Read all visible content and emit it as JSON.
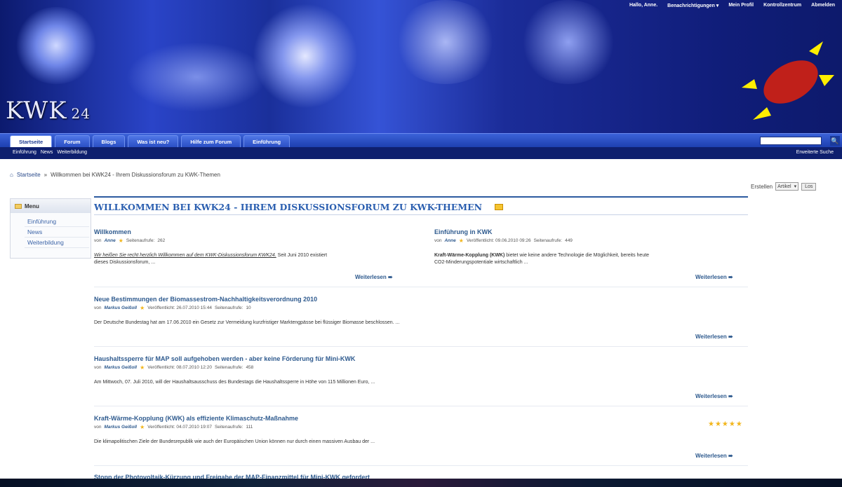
{
  "userbar": {
    "greeting": "Hallo, Anne.",
    "notifications": "Benachrichtigungen ▾",
    "profile": "Mein Profil",
    "control": "Kontrollzentrum",
    "logout": "Abmelden"
  },
  "logo": {
    "text": "KWK",
    "suffix": "24"
  },
  "nav": {
    "tabs": [
      "Startseite",
      "Forum",
      "Blogs",
      "Was ist neu?",
      "Hilfe zum Forum",
      "Einführung"
    ],
    "search_icon": "search-icon"
  },
  "subnav": {
    "links": [
      "Einführung",
      "News",
      "Weiterbildung"
    ],
    "advanced": "Erweiterte Suche"
  },
  "breadcrumb": {
    "home": "Startseite",
    "sep": "»",
    "current": "Willkommen bei KWK24 - Ihrem Diskussionsforum zu KWK-Themen"
  },
  "create": {
    "label": "Erstellen",
    "select": "Artikel",
    "button": "Los"
  },
  "menu": {
    "title": "Menu",
    "items": [
      "Einführung",
      "News",
      "Weiterbildung"
    ]
  },
  "main": {
    "title": "WILLKOMMEN BEI KWK24 - IHREM DISKUSSIONSFORUM ZU KWK-THEMEN"
  },
  "articles": [
    {
      "title": "Willkommen",
      "by": "von",
      "author": "Anne",
      "views_label": "Seitenaufrufe:",
      "views": "262",
      "body_u": "Wir heißen Sie recht herzlich Willkommen auf dem KWK-Diskussionsforum KWK24.",
      "body": " Seit Juni 2010 existiert",
      "body2": "dieses Diskussionsforum, ...",
      "more": "Weiterlesen ➠"
    },
    {
      "title": "Einführung in KWK",
      "by": "von",
      "author": "Anne",
      "date": "Veröffentlicht: 09.06.2010 09:26",
      "views_label": "Seitenaufrufe:",
      "views": "449",
      "body_b": "Kraft-Wärme-Kopplung (KWK)",
      "body": " bietet wie keine andere Technologie die Möglichkeit, bereits heute",
      "body2": "CO2-Minderungspotentiale wirtschaftlich ...",
      "more": "Weiterlesen ➠"
    },
    {
      "title": "Neue Bestimmungen der Biomassestrom-Nachhaltigkeitsverordnung 2010",
      "by": "von",
      "author": "Markus Geißoll",
      "date": "Veröffentlicht: 26.07.2010 15:44",
      "views_label": "Seitenaufrufe:",
      "views": "10",
      "body": "Der Deutsche Bundestag hat am 17.06.2010 ein Gesetz zur Vermeidung kurzfristiger Marktengpässe bei flüssiger Biomasse beschlossen. ...",
      "more": "Weiterlesen ➠"
    },
    {
      "title": "Haushaltssperre für MAP soll aufgehoben werden - aber keine Förderung für Mini-KWK",
      "by": "von",
      "author": "Markus Geißoll",
      "date": "Veröffentlicht: 08.07.2010 12:20",
      "views_label": "Seitenaufrufe:",
      "views": "458",
      "body": "Am Mittwoch, 07. Juli 2010, will der Haushaltsausschuss des Bundestags die Haushaltssperre in Höhe von 115 Millionen Euro, ...",
      "more": "Weiterlesen ➠"
    },
    {
      "title": "Kraft-Wärme-Kopplung (KWK) als effiziente Klimaschutz-Maßnahme",
      "by": "von",
      "author": "Markus Geißoll",
      "date": "Veröffentlicht: 04.07.2010 19:07",
      "views_label": "Seitenaufrufe:",
      "views": "111",
      "body": "Die klimapolitischen Ziele der Bundesrepublik wie auch der Europäischen Union können nur durch einen massiven Ausbau der ...",
      "more": "Weiterlesen ➠",
      "rating": "★★★★★"
    },
    {
      "title": "Stopp der Photovoltaik-Kürzung und Freigabe der MAP-Finanzmittel für Mini-KWK gefordert"
    }
  ],
  "colors": {
    "nav": "#2a4fc4",
    "subnav": "#0e1f6e",
    "link": "#2e5a8e",
    "title": "#2b5fb0",
    "star": "#f2b51a"
  }
}
